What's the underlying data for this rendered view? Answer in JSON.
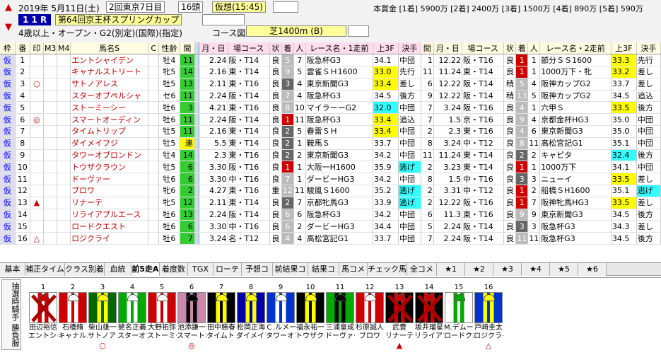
{
  "header": {
    "date": "2019年 5月11日(土)",
    "meeting": "2回東京7日目",
    "runners": "16頭",
    "forecast_label": "仮想(15:45)",
    "race_no": "1 1 R",
    "race_name": "第64回京王杯スプリングカップ",
    "conditions": "4歳以上・オープン・G2(別定)(国際)(指定)",
    "course_label": "コース図",
    "course": "芝1400m (B)",
    "prize": "本賞金 [1着] 5900万 [2着] 2400万 [3着] 1500万 [4着] 890万 [5着] 590万"
  },
  "columns": [
    "枠",
    "番",
    "印",
    "M3",
    "M4",
    "馬名S",
    "C",
    "性齢",
    "間",
    "月・日",
    "場コース",
    "状",
    "着",
    "人",
    "レース名・1走前",
    "上3F",
    "決手",
    "間",
    "月・日",
    "場コース",
    "状",
    "着",
    "人",
    "レース名・2走前",
    "上3F",
    "決手"
  ],
  "rows": [
    {
      "waku": "仮",
      "no": "1",
      "mark": "",
      "name": "エントシャイデン",
      "c": "",
      "sex": "牡4",
      "gap": "11",
      "d1": "2.24",
      "c1": "阪・T14",
      "s1": "良",
      "p1": "5",
      "n1": "7",
      "r1": "阪急杯G3",
      "f1": "34.1",
      "k1": "中団",
      "g2": "1",
      "d2": "12.22",
      "c2": "阪・T16",
      "s2": "良",
      "p2": "1",
      "n2": "1",
      "r2": "節分ＳＳ1600",
      "f2": "33.3",
      "k2": "先行"
    },
    {
      "waku": "仮",
      "no": "2",
      "mark": "",
      "name": "キャナルストリート",
      "c": "",
      "sex": "牝5",
      "gap": "14",
      "d1": "2.16",
      "c1": "東・T14",
      "s1": "良",
      "p1": "9",
      "n1": "5",
      "r1": "雲雀ＳＨ1600",
      "f1": "33.0",
      "k1": "先行",
      "g2": "11",
      "d2": "11.24",
      "c2": "東・T14",
      "s2": "良",
      "p2": "1",
      "n2": "1",
      "r2": "1000万下・牝",
      "f2": "33.2",
      "k2": "差し"
    },
    {
      "waku": "仮",
      "no": "3",
      "mark": "○",
      "name": "サトノアレス",
      "c": "",
      "sex": "牡5",
      "gap": "13",
      "d1": "2.11",
      "c1": "東・T16",
      "s1": "良",
      "p1": "3",
      "n1": "4",
      "r1": "東京新聞G3",
      "f1": "33.4",
      "k1": "差し",
      "g2": "6",
      "d2": "12.22",
      "c2": "阪・T14",
      "s2": "稍",
      "p2": "5",
      "n2": "4",
      "r2": "阪神カップG2",
      "f2": "33.7",
      "k2": "差し"
    },
    {
      "waku": "仮",
      "no": "4",
      "mark": "",
      "name": "スターオブペルシャ",
      "c": "",
      "sex": "セ6",
      "gap": "11",
      "d1": "2.24",
      "c1": "阪・T14",
      "s1": "良",
      "p1": "7",
      "n1": "4",
      "r1": "阪急杯G3",
      "f1": "34.5",
      "k1": "後方",
      "g2": "9",
      "d2": "12.22",
      "c2": "阪・T14",
      "s2": "稍",
      "p2": "13",
      "n2": "5",
      "r2": "阪神カップG2",
      "f2": "34.5",
      "k2": "追込"
    },
    {
      "waku": "仮",
      "no": "5",
      "mark": "",
      "name": "ストーミーシー",
      "c": "",
      "sex": "牡6",
      "gap": "3",
      "d1": "4.21",
      "c1": "東・T16",
      "s1": "良",
      "p1": "8",
      "n1": "10",
      "r1": "マイラーーG2",
      "f1": "32.0",
      "k1": "中団",
      "g2": "7",
      "d2": "3.24",
      "c2": "阪・T16",
      "s2": "良",
      "p2": "4",
      "n2": "1",
      "r2": "六甲Ｓ",
      "f2": "33.5",
      "k2": "後方"
    },
    {
      "waku": "仮",
      "no": "6",
      "mark": "◎",
      "name": "スマートオーディン",
      "c": "",
      "sex": "牡6",
      "gap": "11",
      "d1": "2.24",
      "c1": "阪・T14",
      "s1": "良",
      "p1": "1",
      "n1": "11",
      "r1": "阪急杯G3",
      "f1": "33.4",
      "k1": "追込",
      "g2": "7",
      "d2": "1.5",
      "c2": "京・T16",
      "s2": "良",
      "p2": "9",
      "n2": "4",
      "r2": "京都金杯HG3",
      "f2": "35.0",
      "k2": "中団"
    },
    {
      "waku": "仮",
      "no": "7",
      "mark": "",
      "name": "タイムトリップ",
      "c": "",
      "sex": "牡5",
      "gap": "11",
      "d1": "2.16",
      "c1": "東・T14",
      "s1": "良",
      "p1": "2",
      "n1": "5",
      "r1": "春雷ＳＨ",
      "f1": "33.4",
      "k1": "中団",
      "g2": "2",
      "d2": "2.3",
      "c2": "東・T16",
      "s2": "良",
      "p2": "4",
      "n2": "6",
      "r2": "東京新聞G3",
      "f2": "35.0",
      "k2": "中団"
    },
    {
      "waku": "仮",
      "no": "8",
      "mark": "",
      "name": "ダイメイフジ",
      "c": "",
      "sex": "牡5",
      "gap": "連",
      "d1": "5.5",
      "c1": "東・T14",
      "s1": "良",
      "p1": "2",
      "n1": "1",
      "r1": "鞍馬Ｓ",
      "f1": "33.7",
      "k1": "中団",
      "g2": "8",
      "d2": "3.24",
      "c2": "中・T12",
      "s2": "良",
      "p2": "8",
      "n2": "11",
      "r2": "高松宮記G1",
      "f2": "35.1",
      "k2": "中団"
    },
    {
      "waku": "仮",
      "no": "9",
      "mark": "",
      "name": "タワーオブロンドン",
      "c": "",
      "sex": "牡4",
      "gap": "14",
      "d1": "2.3",
      "c1": "東・T16",
      "s1": "良",
      "p1": "2",
      "n1": "2",
      "r1": "東京新聞G3",
      "f1": "34.2",
      "k1": "中団",
      "g2": "11",
      "d2": "11.24",
      "c2": "東・T14",
      "s2": "良",
      "p2": "2",
      "n2": "2",
      "r2": "キャピタ",
      "f2": "32.4",
      "k2": "後方"
    },
    {
      "waku": "仮",
      "no": "10",
      "mark": "",
      "name": "トウザクラウン",
      "c": "",
      "sex": "牡5",
      "gap": "6",
      "d1": "3.30",
      "c1": "阪・T16",
      "s1": "良",
      "p1": "1",
      "n1": "1",
      "r1": "大阪一H1600",
      "f1": "35.9",
      "k1": "逃げ",
      "g2": "2",
      "d2": "3.23",
      "c2": "東・T14",
      "s2": "良",
      "p2": "1",
      "n2": "1",
      "r2": "1000万下",
      "f2": "34.1",
      "k2": "中団"
    },
    {
      "waku": "仮",
      "no": "11",
      "mark": "",
      "name": "ドーヴァー",
      "c": "",
      "sex": "牡6",
      "gap": "6",
      "d1": "3.30",
      "c1": "中・T16",
      "s1": "良",
      "p1": "7",
      "n1": "1",
      "r1": "ダービーHG3",
      "f1": "34.2",
      "k1": "中団",
      "g2": "8",
      "d2": "1.5",
      "c2": "中・T16",
      "s2": "良",
      "p2": "3",
      "n2": "3",
      "r2": "ニューイ",
      "f2": "33.5",
      "k2": "差し"
    },
    {
      "waku": "仮",
      "no": "12",
      "mark": "",
      "name": "ブロワ",
      "c": "",
      "sex": "牝6",
      "gap": "2",
      "d1": "4.27",
      "c1": "東・T16",
      "s1": "重",
      "p1": "12",
      "n1": "11",
      "r1": "駿風Ｓ1600",
      "f1": "35.2",
      "k1": "逃げ",
      "g2": "2",
      "d2": "3.31",
      "c2": "中・T12",
      "s2": "良",
      "p2": "1",
      "n2": "2",
      "r2": "船橋ＳH1600",
      "f2": "35.1",
      "k2": "逃げ"
    },
    {
      "waku": "仮",
      "no": "13",
      "mark": "▲",
      "name": "リナーテ",
      "c": "",
      "sex": "牝5",
      "gap": "12",
      "d1": "2.11",
      "c1": "東・T14",
      "s1": "良",
      "p1": "2",
      "n1": "7",
      "r1": "京都牝馬G3",
      "f1": "33.9",
      "k1": "逃げ",
      "g2": "2",
      "d2": "12.22",
      "c2": "阪・T16",
      "s2": "良",
      "p2": "1",
      "n2": "7",
      "r2": "阪神牝馬HG3",
      "f2": "33.5",
      "k2": "差し"
    },
    {
      "waku": "仮",
      "no": "14",
      "mark": "",
      "name": "リライアブルエース",
      "c": "",
      "sex": "牡6",
      "gap": "13",
      "d1": "2.24",
      "c1": "阪・T14",
      "s1": "良",
      "p1": "6",
      "n1": "6",
      "r1": "阪急杯G3",
      "f1": "34.2",
      "k1": "中団",
      "g2": "6",
      "d2": "11.3",
      "c2": "東・T16",
      "s2": "良",
      "p2": "9",
      "n2": "9",
      "r2": "東京新聞G3",
      "f2": "34.5",
      "k2": "後方"
    },
    {
      "waku": "仮",
      "no": "15",
      "mark": "",
      "name": "ロードクエスト",
      "c": "",
      "sex": "牡6",
      "gap": "6",
      "d1": "3.30",
      "c1": "中・T16",
      "s1": "良",
      "p1": "6",
      "n1": "2",
      "r1": "ダービーHG3",
      "f1": "34.4",
      "k1": "中団",
      "g2": "5",
      "d2": "2.24",
      "c2": "阪・T14",
      "s2": "良",
      "p2": "3",
      "n2": "3",
      "r2": "阪急杯G3",
      "f2": "34.3",
      "k2": "差し"
    },
    {
      "waku": "仮",
      "no": "16",
      "mark": "△",
      "name": "ロジクライ",
      "c": "",
      "sex": "牡6",
      "gap": "7",
      "d1": "3.24",
      "c1": "名・T12",
      "s1": "良",
      "p1": "4",
      "n1": "4",
      "r1": "高松宮記G1",
      "f1": "33.7",
      "k1": "中団",
      "g2": "7",
      "d2": "2.24",
      "c2": "阪・T14",
      "s2": "良",
      "p2": "11",
      "n2": "11",
      "r2": "阪急杯G3",
      "f2": "34.5",
      "k2": "後方"
    }
  ],
  "tabs": [
    "基本",
    "補正タイム",
    "クラス別着",
    "血統",
    "前5走A",
    "着度数",
    "TGX",
    "ローテ",
    "予想コメ",
    "前結果コメ",
    "結果コメ",
    "馬コメ",
    "チェック馬コメ",
    "全コメ",
    "★1",
    "★2",
    "★3",
    "★4",
    "★5",
    "★6"
  ],
  "selected_tab": "前5走A",
  "bottom": {
    "vlabel": "抽選時騎手 勝負服",
    "slots": [
      {
        "num": "1",
        "jockey": "田辺裕信",
        "horse": "エントシャ",
        "mark": "",
        "x": true,
        "colors": [
          "#fff",
          "#c00"
        ]
      },
      {
        "num": "2",
        "jockey": "石橋脩",
        "horse": "キャナルス",
        "mark": "",
        "x": false,
        "colors": [
          "#c00",
          "#fff"
        ]
      },
      {
        "num": "3",
        "jockey": "柴山雄一",
        "horse": "サトノアレ",
        "mark": "○",
        "x": false,
        "colors": [
          "#060",
          "#ff0"
        ]
      },
      {
        "num": "4",
        "jockey": "蛯名正義",
        "horse": "スターオブ",
        "mark": "",
        "x": false,
        "colors": [
          "#0a0",
          "#fff"
        ]
      },
      {
        "num": "5",
        "jockey": "大野拓弥",
        "horse": "ストーミー",
        "mark": "",
        "x": false,
        "colors": [
          "#c00",
          "#fff"
        ]
      },
      {
        "num": "6",
        "jockey": "池添謙一",
        "horse": "スマートオ",
        "mark": "◎",
        "x": false,
        "colors": [
          "#c8a",
          "#000"
        ]
      },
      {
        "num": "7",
        "jockey": "田中勝春",
        "horse": "タイムトリ",
        "mark": "",
        "x": false,
        "colors": [
          "#000",
          "#ff0"
        ]
      },
      {
        "num": "8",
        "jockey": "松岡正海",
        "horse": "ダイメイフ",
        "mark": "",
        "x": false,
        "colors": [
          "#00a",
          "#ff0"
        ]
      },
      {
        "num": "9",
        "jockey": "Ｃ.ルメール",
        "horse": "タワーオブ",
        "mark": "",
        "x": false,
        "colors": [
          "#03c",
          "#fff"
        ]
      },
      {
        "num": "10",
        "jockey": "福永祐一",
        "horse": "トウザクラ",
        "mark": "",
        "x": false,
        "colors": [
          "#000",
          "#ff0"
        ]
      },
      {
        "num": "11",
        "jockey": "三浦皇成",
        "horse": "ドーヴァー",
        "mark": "",
        "x": false,
        "colors": [
          "#0a0",
          "#000"
        ]
      },
      {
        "num": "12",
        "jockey": "杉原誠人",
        "horse": "ブロワ",
        "mark": "",
        "x": false,
        "colors": [
          "#c00",
          "#fff"
        ]
      },
      {
        "num": "13",
        "jockey": "武豊",
        "horse": "リナーテ",
        "mark": "▲",
        "x": true,
        "colors": [
          "#000",
          "#c00"
        ]
      },
      {
        "num": "14",
        "jockey": "坂井瑠星",
        "horse": "リライアブ",
        "mark": "",
        "x": true,
        "colors": [
          "#000",
          "#c00"
        ]
      },
      {
        "num": "15",
        "jockey": "M.デムーロ",
        "horse": "ロードクエ",
        "mark": "",
        "x": false,
        "colors": [
          "#fff",
          "#0a0"
        ]
      },
      {
        "num": "16",
        "jockey": "戸崎圭太",
        "horse": "ロジクライ",
        "mark": "△",
        "x": false,
        "colors": [
          "#03c",
          "#ff0"
        ]
      }
    ]
  }
}
